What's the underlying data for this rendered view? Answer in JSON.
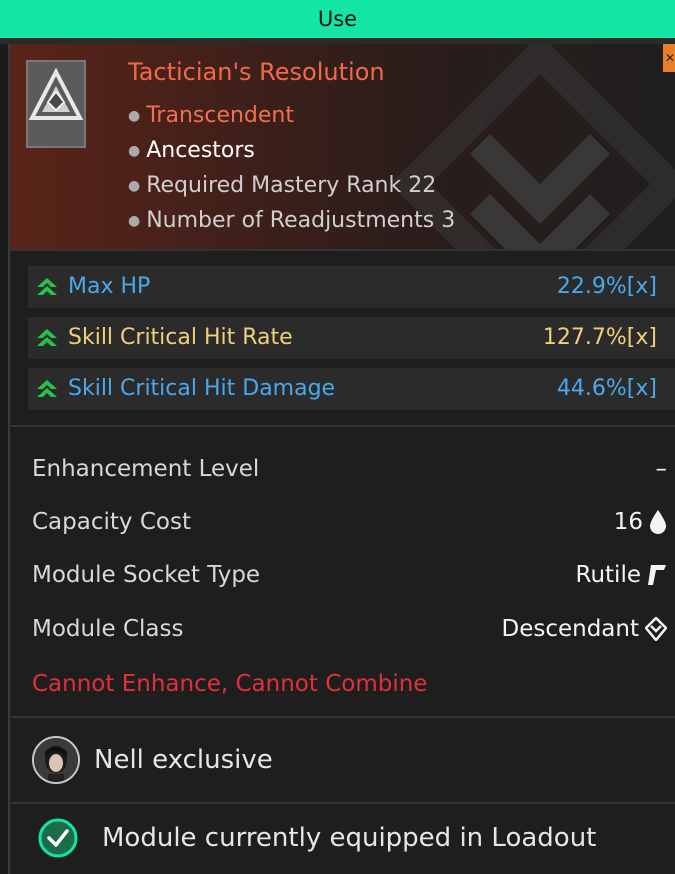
{
  "top_bar": {
    "label": "Use"
  },
  "module": {
    "name": "Tactician's Resolution",
    "tags": [
      {
        "text": "Transcendent",
        "kind": "rarity"
      },
      {
        "text": "Ancestors",
        "kind": "socket"
      },
      {
        "text": "Required Mastery Rank 22",
        "kind": "dim"
      },
      {
        "text": "Number of Readjustments 3",
        "kind": "dim"
      }
    ]
  },
  "stats": [
    {
      "name": "Max HP",
      "value": "22.9%[x]",
      "color": "#4aa8ec"
    },
    {
      "name": "Skill Critical Hit Rate",
      "value": "127.7%[x]",
      "color": "#f0d07a"
    },
    {
      "name": "Skill Critical Hit Damage",
      "value": "44.6%[x]",
      "color": "#4aa8ec"
    }
  ],
  "info": {
    "enhancement": {
      "label": "Enhancement Level",
      "value": "–"
    },
    "capacity": {
      "label": "Capacity Cost",
      "value": "16",
      "icon": "drop-icon"
    },
    "socket": {
      "label": "Module Socket Type",
      "value": "Rutile",
      "icon": "rutile-socket-icon"
    },
    "class": {
      "label": "Module Class",
      "value": "Descendant",
      "icon": "descendant-class-icon"
    }
  },
  "warning": "Cannot Enhance, Cannot Combine",
  "exclusive": {
    "text": "Nell exclusive",
    "icon": "nell-avatar"
  },
  "equipped": {
    "text": "Module currently equipped in Loadout",
    "icon": "check-circle-icon"
  },
  "colors": {
    "accent_green": "#13e6a2",
    "rarity": "#f07050",
    "stat_blue": "#4aa8ec",
    "stat_gold": "#f0d07a",
    "warning": "#e0303c"
  }
}
